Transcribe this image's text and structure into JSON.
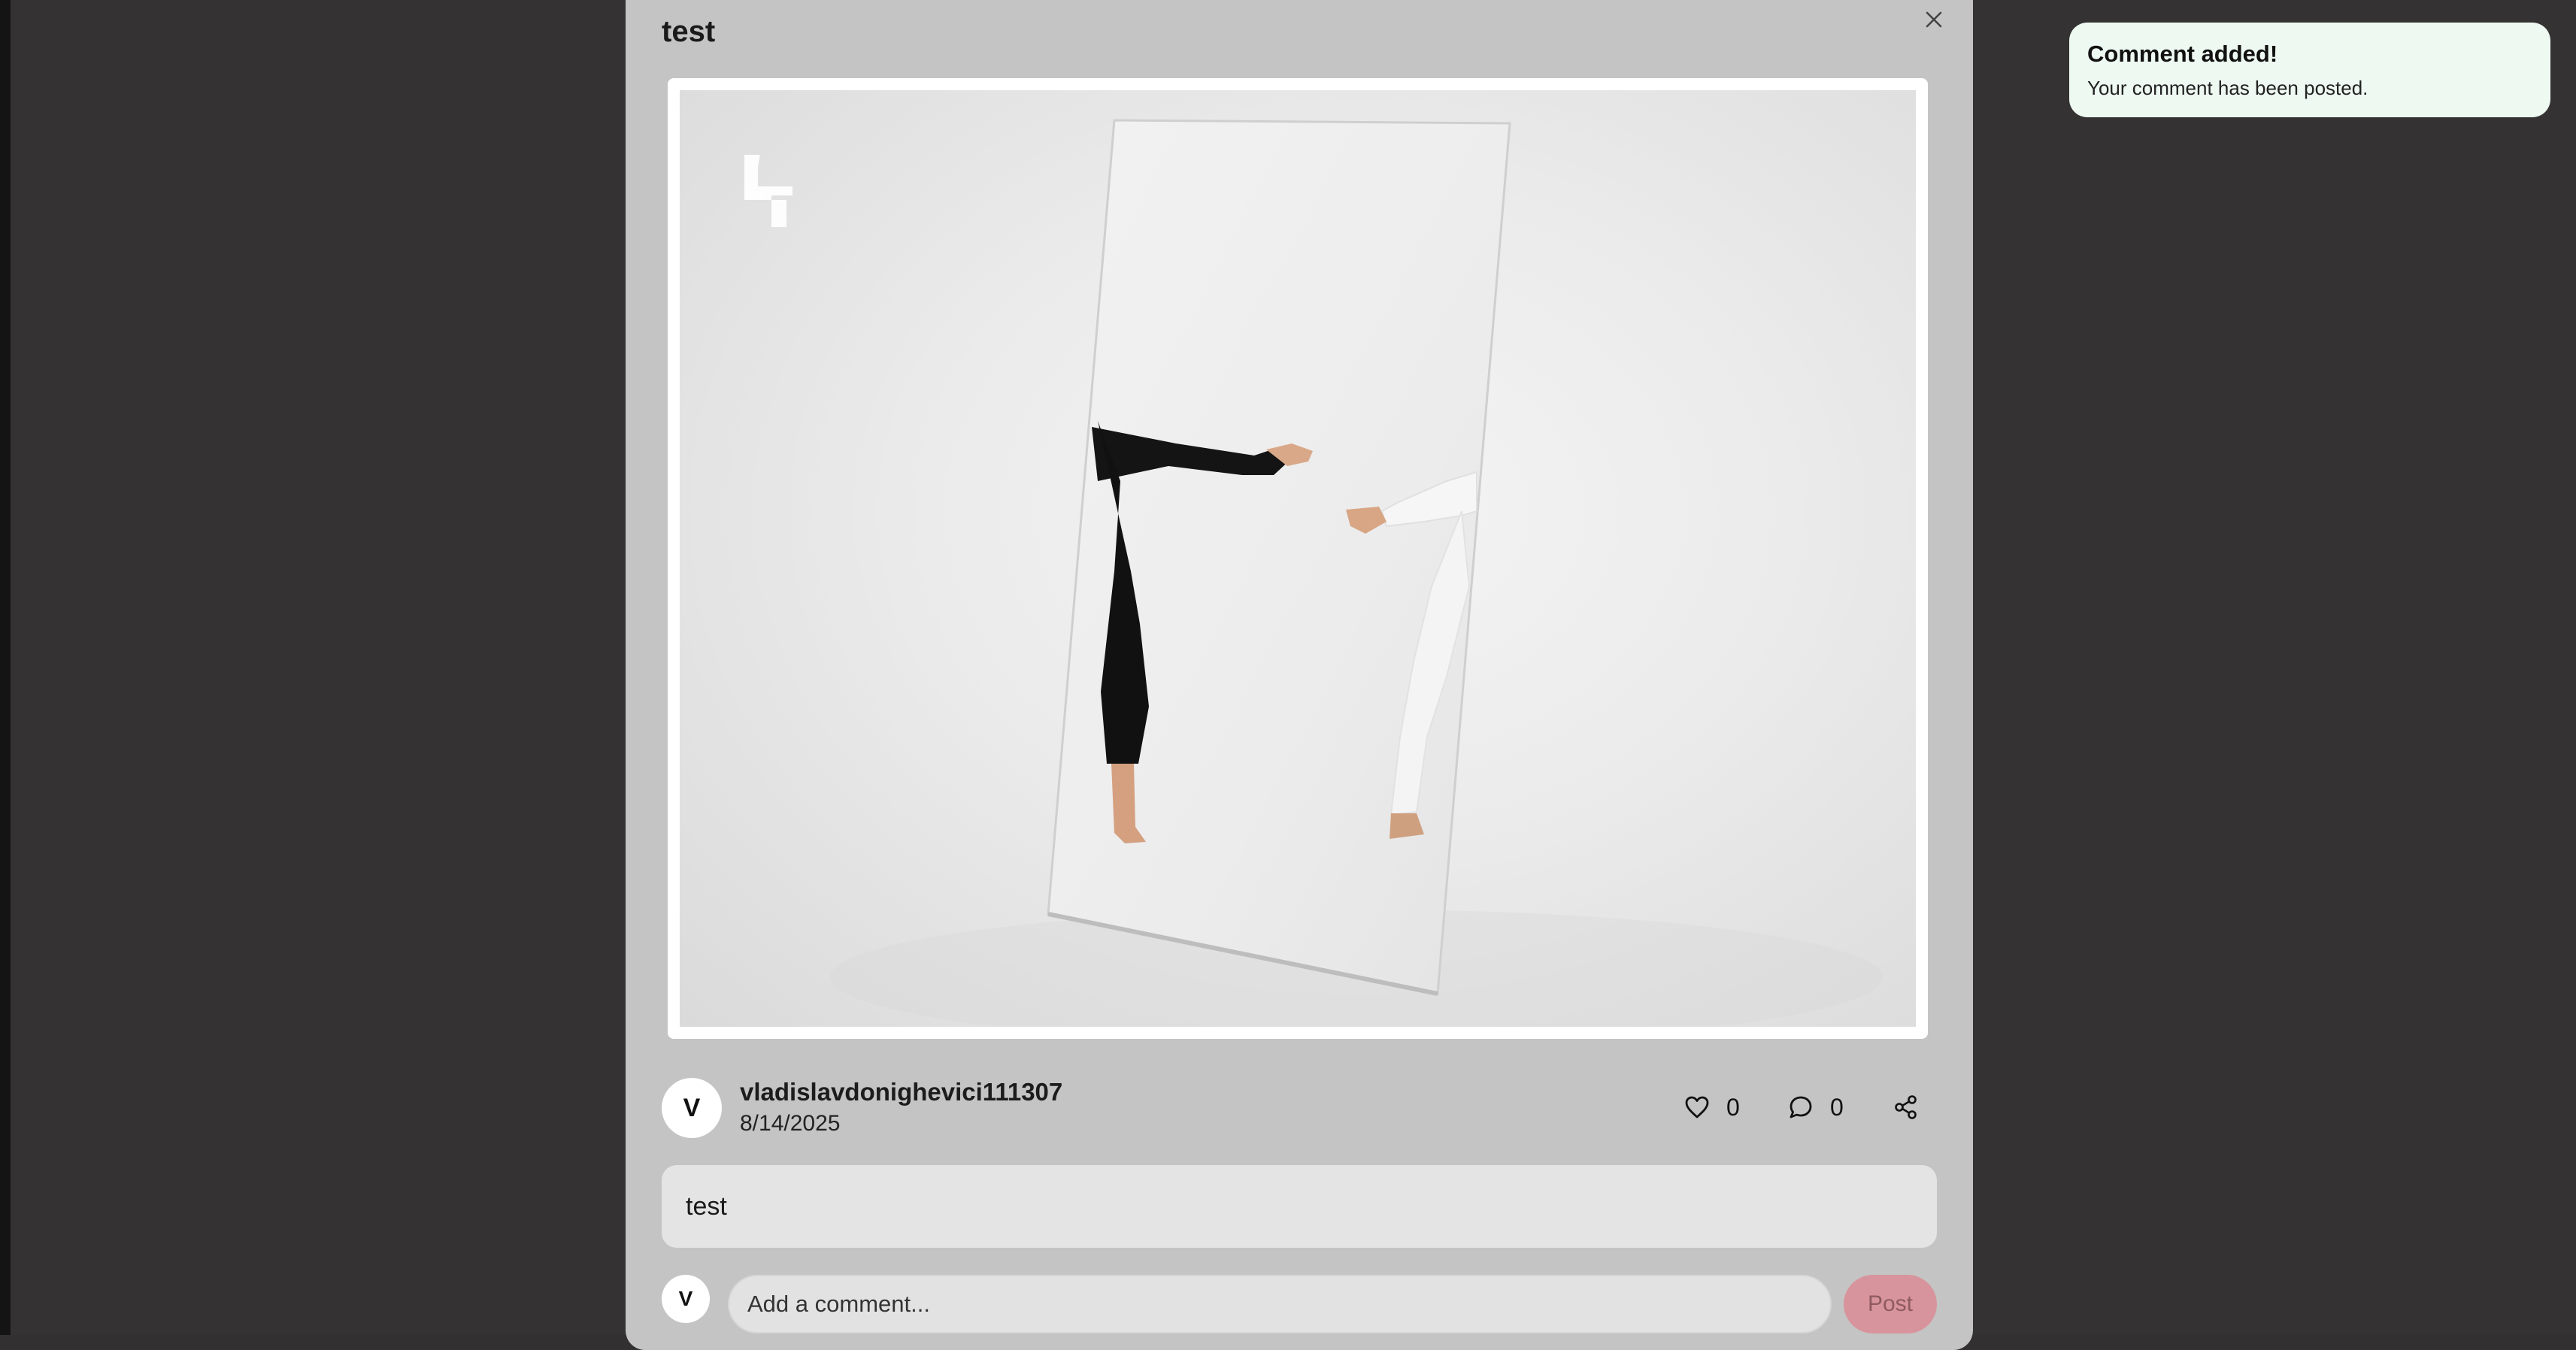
{
  "modal": {
    "title": "test"
  },
  "post": {
    "author": {
      "initial": "V",
      "username": "vladislavdonighevici111307"
    },
    "date": "8/14/2025",
    "likes": "0",
    "comments": "0",
    "body": "test",
    "image": {
      "description_icon": "watermark-logo-icon"
    }
  },
  "composer": {
    "avatar_initial": "V",
    "placeholder": "Add a comment...",
    "value": "",
    "post_label": "Post"
  },
  "toast": {
    "title": "Comment added!",
    "message": "Your comment has been posted."
  },
  "icons": {
    "close": "close-icon",
    "like": "heart-icon",
    "comment": "comment-bubble-icon",
    "share": "share-icon"
  },
  "colors": {
    "toast_background": "#eef9f1",
    "post_button": "#d8949c",
    "modal_background": "#c4c4c4",
    "backdrop": "#343232"
  }
}
